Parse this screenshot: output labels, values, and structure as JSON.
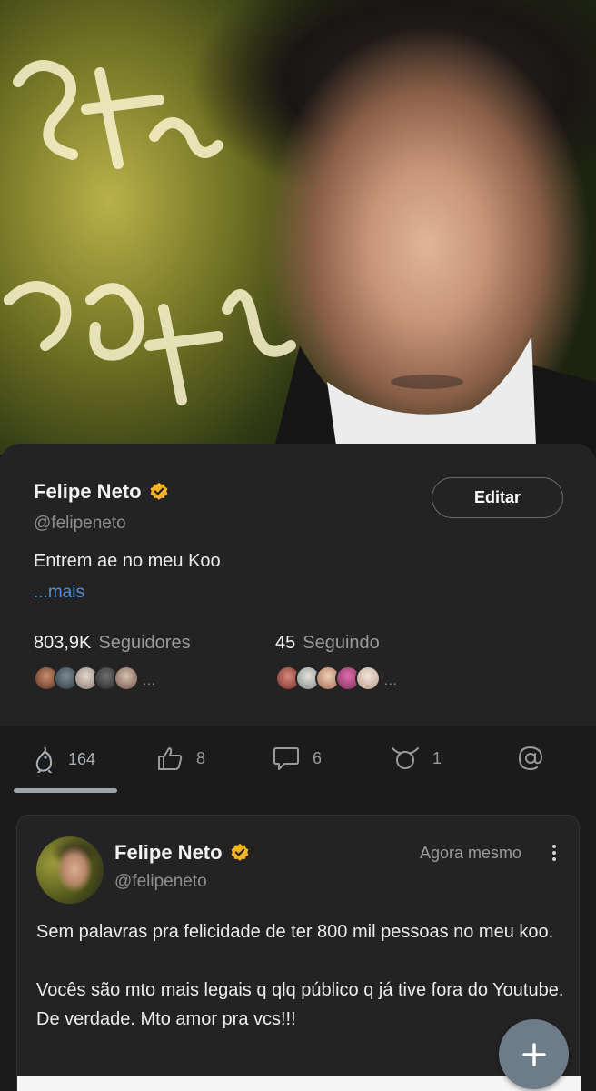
{
  "profile": {
    "name": "Felipe Neto",
    "handle": "@felipeneto",
    "bio": "Entrem ae no meu Koo",
    "more_link": "...mais",
    "edit_label": "Editar",
    "followers": {
      "count": "803,9K",
      "label": "Seguidores"
    },
    "following": {
      "count": "45",
      "label": "Seguindo"
    },
    "avatars_more": "..."
  },
  "tabs": [
    {
      "icon": "koo-bird-icon",
      "count": "164"
    },
    {
      "icon": "thumbs-up-icon",
      "count": "8"
    },
    {
      "icon": "comment-icon",
      "count": "6"
    },
    {
      "icon": "rekoo-icon",
      "count": "1"
    },
    {
      "icon": "mention-icon",
      "count": ""
    }
  ],
  "post": {
    "name": "Felipe Neto",
    "handle": "@felipeneto",
    "time": "Agora mesmo",
    "paragraphs": [
      "Sem palavras pra felicidade de ter 800 mil pessoas no meu koo.",
      "Vocês são mto mais legais q qlq público q já tive fora do Youtube. De verdade. Mto amor pra vcs!!!"
    ]
  },
  "colors": {
    "verified": "#f5b325",
    "link": "#4a8fe0",
    "fab": "#6d7c88"
  }
}
